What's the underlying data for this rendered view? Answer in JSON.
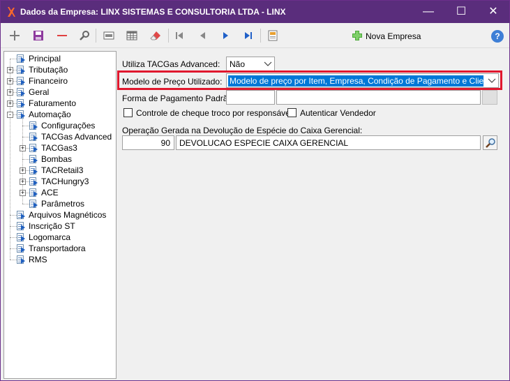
{
  "window": {
    "title": "Dados da Empresa: LINX SISTEMAS E CONSULTORIA LTDA - LINX",
    "minimize": "—",
    "maximize": "☐",
    "close": "✕"
  },
  "toolbar": {
    "nova_empresa_label": "Nova Empresa",
    "help_label": "?"
  },
  "tree": {
    "items": [
      {
        "label": "Principal"
      },
      {
        "label": "Tributação"
      },
      {
        "label": "Financeiro"
      },
      {
        "label": "Geral"
      },
      {
        "label": "Faturamento"
      },
      {
        "label": "Automação"
      },
      {
        "label": "Configurações"
      },
      {
        "label": "TACGas Advanced"
      },
      {
        "label": "TACGas3"
      },
      {
        "label": "Bombas"
      },
      {
        "label": "TACRetail3"
      },
      {
        "label": "TACHungry3"
      },
      {
        "label": "ACE"
      },
      {
        "label": "Parâmetros"
      },
      {
        "label": "Arquivos Magnéticos"
      },
      {
        "label": "Inscrição ST"
      },
      {
        "label": "Logomarca"
      },
      {
        "label": "Transportadora"
      },
      {
        "label": "RMS"
      }
    ]
  },
  "form": {
    "utiliza_label": "Utiliza TACGas Advanced:",
    "utiliza_value": "Não",
    "modelo_label": "Modelo de Preço Utilizado:",
    "modelo_value": "Modelo de preço por Item, Empresa, Condição de Pagamento e Cliente",
    "forma_label": "Forma de Pagamento Padrão:",
    "forma_code": "",
    "forma_desc": "",
    "cheque_label": "Controle de cheque troco por responsável",
    "autenticar_label": "Autenticar Vendedor",
    "operacao_label": "Operação Gerada na Devolução de Espécie do Caixa Gerencial:",
    "operacao_code": "90",
    "operacao_desc": "DEVOLUCAO ESPECIE CAIXA GERENCIAL"
  },
  "colors": {
    "titlebar": "#5a2d7c",
    "highlight": "#e0182e",
    "selection": "#0078d7"
  }
}
